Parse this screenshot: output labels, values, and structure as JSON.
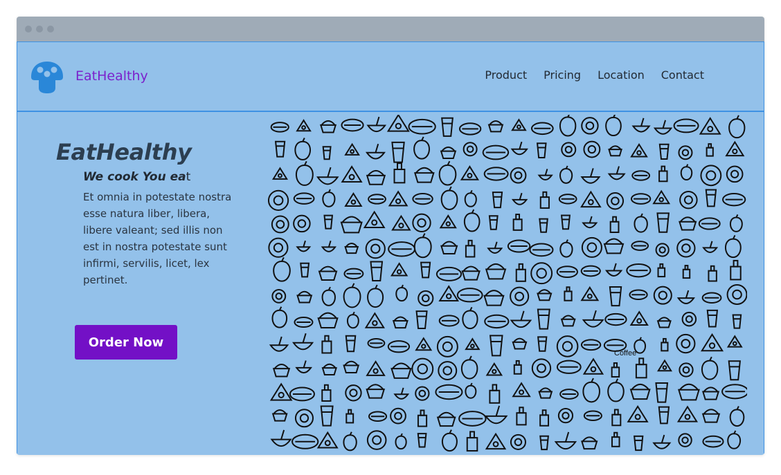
{
  "colors": {
    "titlebar": "#9fabb7",
    "page_background": "#93c1ea",
    "accent_border": "#3f92e3",
    "brand_text": "#7b22cc",
    "button": "#7310c6",
    "logo": "#2a87d8"
  },
  "header": {
    "logo_icon": "mushroom-icon",
    "brand": "EatHealthy"
  },
  "nav": {
    "items": [
      {
        "label": "Product"
      },
      {
        "label": "Pricing"
      },
      {
        "label": "Location"
      },
      {
        "label": "Contact"
      }
    ]
  },
  "hero": {
    "title": "EatHealthy",
    "subtitle_em": "We cook You ea",
    "subtitle_rest": "t",
    "body": "Et omnia in potestate nostra esse natura liber, libera, libere valeant; sed illis non est in nostra potestate sunt infirmi, servilis, licet, lex pertinet.",
    "cta": "Order Now"
  },
  "illustration": {
    "icon": "food-doodles-illustration",
    "label": "Coffee"
  }
}
